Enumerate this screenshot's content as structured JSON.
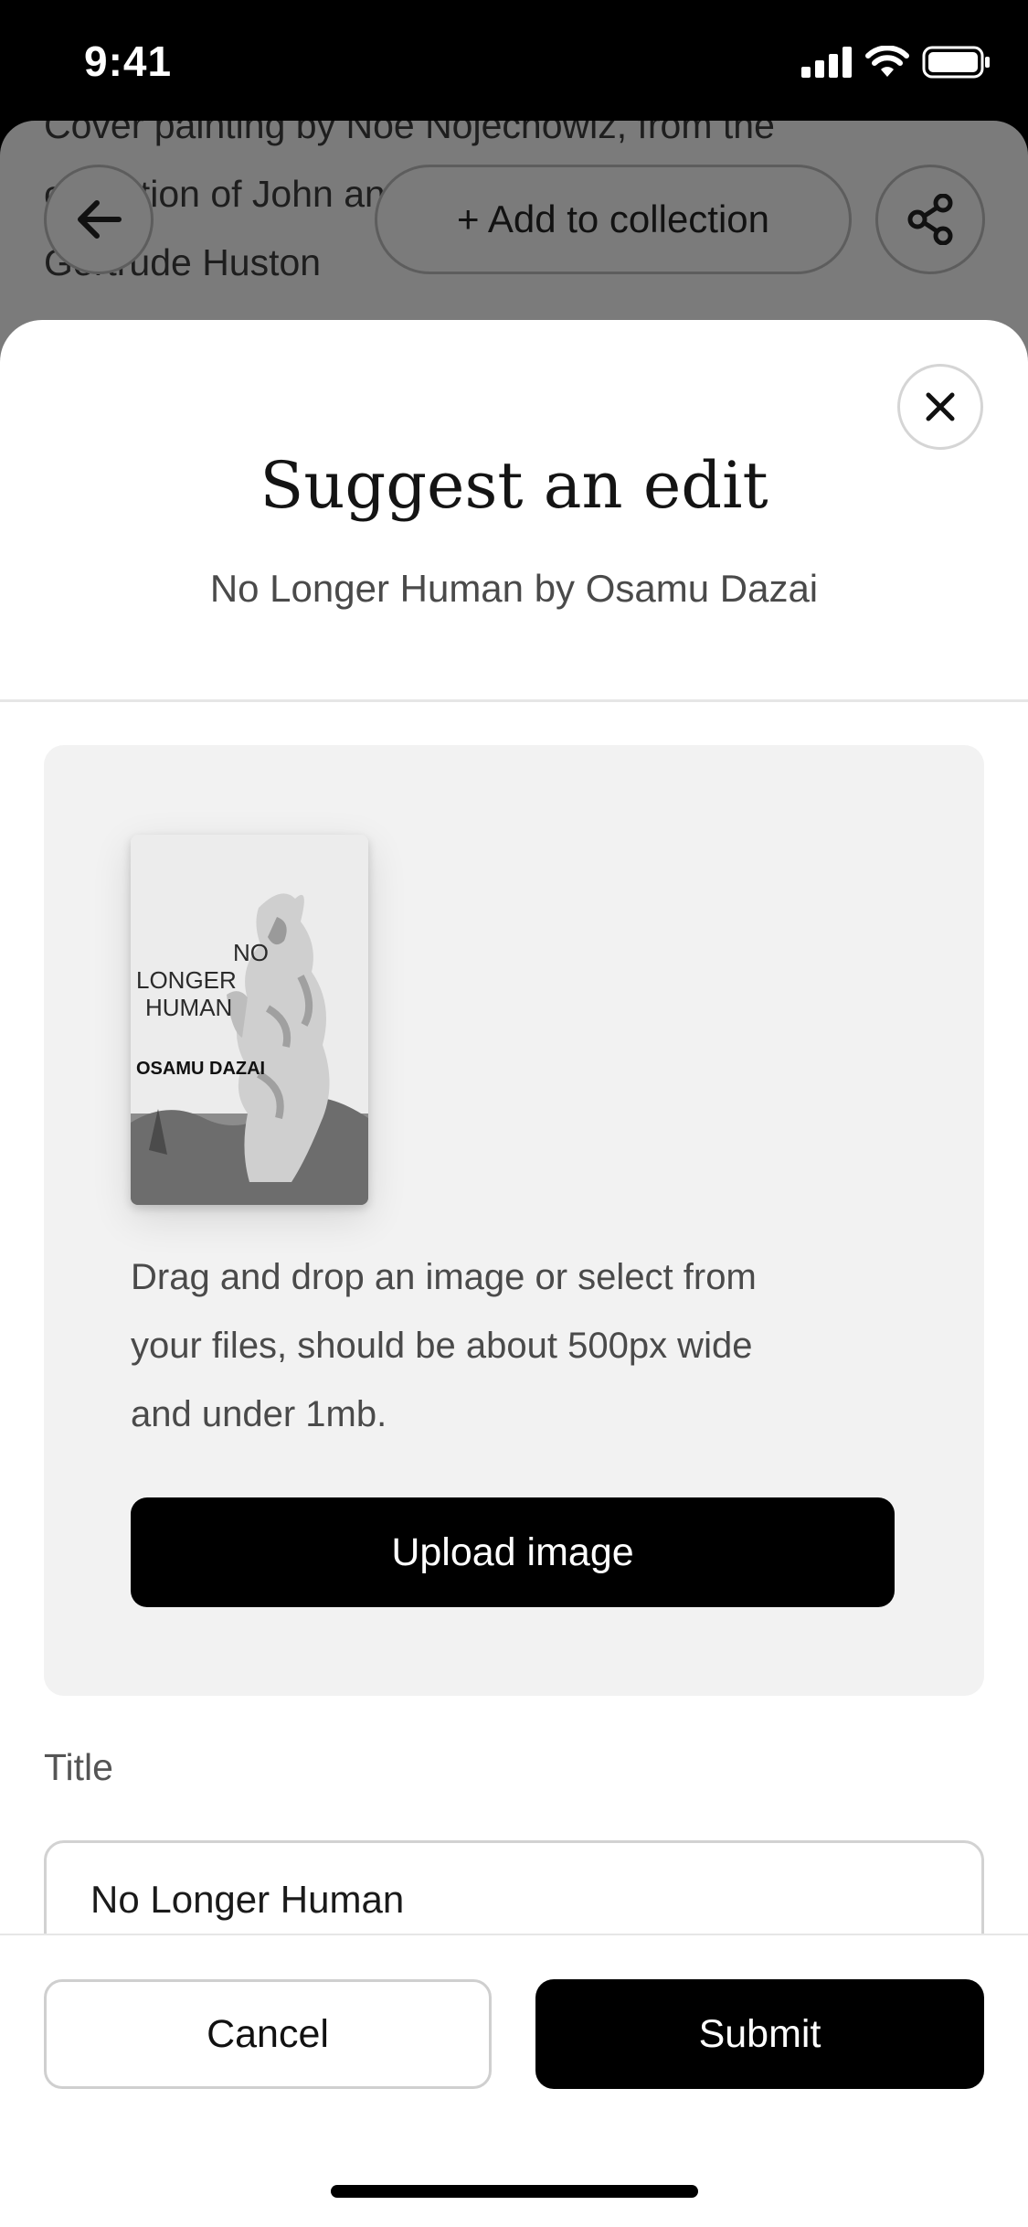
{
  "status_bar": {
    "time": "9:41"
  },
  "background_page": {
    "caption_lines": [
      "Cover painting by Noe Nojechowiz, from the",
      "collection of John and ... design by",
      "Gertrude Huston"
    ],
    "add_to_collection_label": "+ Add to collection"
  },
  "sheet": {
    "title": "Suggest an edit",
    "subtitle": "No Longer Human by Osamu Dazai",
    "cover": {
      "title_lines": [
        "NO",
        "LONGER",
        "HUMAN"
      ],
      "author": "OSAMU DAZAI"
    },
    "upload": {
      "description_lines": [
        "Drag and drop an image or select from",
        "your files, should be about 500px wide",
        "and under 1mb."
      ],
      "button_label": "Upload image"
    },
    "title_field": {
      "label": "Title",
      "value": "No Longer Human"
    },
    "footer": {
      "cancel_label": "Cancel",
      "submit_label": "Submit"
    }
  },
  "icons": {
    "back": "arrow-left-icon",
    "share": "share-icon",
    "close": "close-icon",
    "signal": "cellular-signal-icon",
    "wifi": "wifi-icon",
    "battery": "battery-icon"
  },
  "colors": {
    "primary_button": "#000000",
    "overlay_dim": "#7b7b7b",
    "panel_bg": "#f2f2f2"
  }
}
